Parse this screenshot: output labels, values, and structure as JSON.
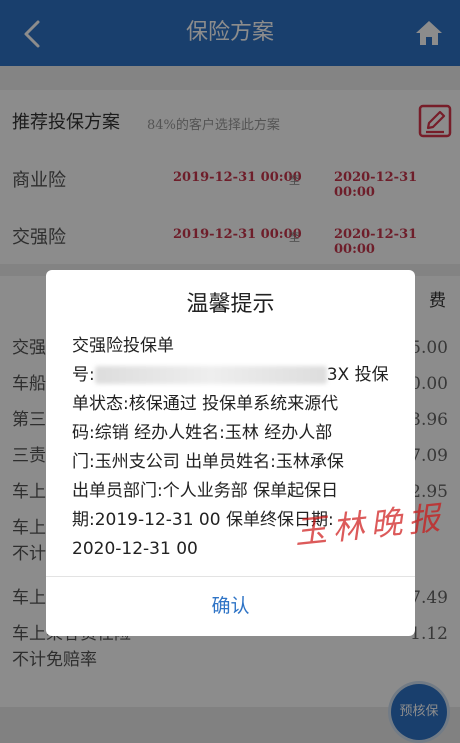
{
  "header": {
    "title": "保险方案"
  },
  "recommend": {
    "title": "推荐投保方案",
    "subtitle": "84%的客户选择此方案"
  },
  "policies": [
    {
      "name": "商业险",
      "start": "2019-12-31 00:00",
      "to": "至",
      "end": "2020-12-31 00:00"
    },
    {
      "name": "交强险",
      "start": "2019-12-31 00:00",
      "to": "至",
      "end": "2020-12-31 00:00"
    }
  ],
  "list": {
    "header_fee": "费",
    "items": [
      {
        "label": "交强",
        "value": "5.00"
      },
      {
        "label": "车船",
        "value": "0.00"
      },
      {
        "label": "第三",
        "value": "3.96"
      },
      {
        "label": "三责",
        "value": "7.09"
      },
      {
        "label": "车上",
        "value": "2.95"
      },
      {
        "label": "车上",
        "label2": "不计",
        "value": ""
      },
      {
        "label": "车上",
        "value": "7.49"
      },
      {
        "label": "车上乘客责任险",
        "label2": "不计免赔率",
        "value": "1.12"
      }
    ]
  },
  "pre_check_button": "预核保",
  "dialog": {
    "title": "温馨提示",
    "line1": "交强险投保单",
    "line2_prefix": "号:",
    "line2_suffix": "3X 投保",
    "line3": "单状态:核保通过 投保单系统来源代",
    "line4": "码:综销 经办人姓名:玉林 经办人部",
    "line5": "门:玉州支公司 出单员姓名:玉林承保",
    "line6": "出单员部门:个人业务部 保单起保日",
    "line7": "期:2019-12-31 00 保单终保日期:",
    "line8": "2020-12-31 00",
    "confirm": "确认"
  },
  "watermark": "玉林晚报",
  "colors": {
    "primary": "#2f74c6",
    "date_red": "#c8374e",
    "edit_red": "#d9354c"
  }
}
